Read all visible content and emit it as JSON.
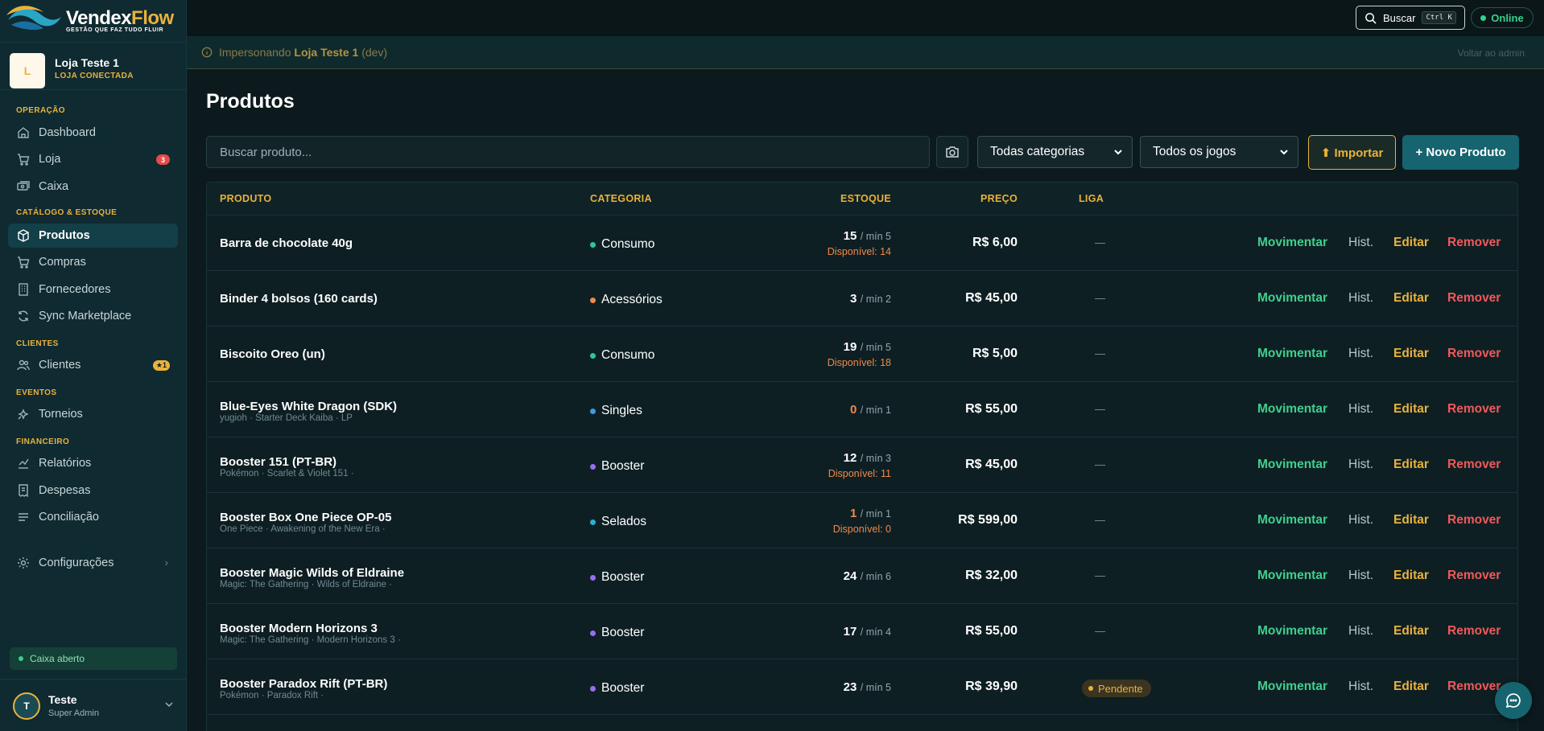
{
  "brand": {
    "name": "Vendex",
    "flow": "Flow",
    "tagline": "GESTÃO QUE FAZ TUDO FLUIR"
  },
  "store": {
    "initial": "L",
    "name": "Loja Teste 1",
    "status": "LOJA CONECTADA"
  },
  "nav": {
    "sections": {
      "operacao": "OPERAÇÃO",
      "catalogo": "CATÁLOGO & ESTOQUE",
      "clientes": "CLIENTES",
      "eventos": "EVENTOS",
      "financeiro": "FINANCEIRO"
    },
    "items": {
      "dashboard": "Dashboard",
      "loja": "Loja",
      "loja_badge": "3",
      "caixa": "Caixa",
      "produtos": "Produtos",
      "compras": "Compras",
      "fornecedores": "Fornecedores",
      "sync": "Sync Marketplace",
      "clientes": "Clientes",
      "clientes_badge": "★1",
      "torneios": "Torneios",
      "relatorios": "Relatórios",
      "despesas": "Despesas",
      "conciliacao": "Conciliação",
      "configuracoes": "Configurações"
    }
  },
  "caixa_status": "Caixa aberto",
  "user": {
    "initial": "T",
    "name": "Teste",
    "role": "Super Admin"
  },
  "topbar": {
    "search_label": "Buscar",
    "shortcut": "Ctrl K",
    "status": "Online"
  },
  "impersonation": {
    "prefix": "Impersonando",
    "store": "Loja Teste 1",
    "suffix": "(dev)",
    "back": "Voltar ao admin"
  },
  "page": {
    "title": "Produtos",
    "search_placeholder": "Buscar produto...",
    "category_select": "Todas categorias",
    "game_select": "Todos os jogos",
    "import_label": "⬆ Importar",
    "new_label": "+ Novo Produto"
  },
  "table": {
    "headers": {
      "produto": "PRODUTO",
      "categoria": "CATEGORIA",
      "estoque": "ESTOQUE",
      "preco": "PREÇO",
      "liga": "LIGA"
    },
    "actions": {
      "mov": "Movimentar",
      "hist": "Hist.",
      "edit": "Editar",
      "remove": "Remover"
    },
    "rows": [
      {
        "name": "Barra de chocolate 40g",
        "sub": "",
        "category": "Consumo",
        "cat_color": "#2ec4a0",
        "qty": "15",
        "min": "/ mín 5",
        "avail": "Disponível: 14",
        "warn": false,
        "price": "R$ 6,00",
        "liga": "—"
      },
      {
        "name": "Binder 4 bolsos (160 cards)",
        "sub": "",
        "category": "Acessórios",
        "cat_color": "#f0894a",
        "qty": "3",
        "min": "/ mín 2",
        "avail": "",
        "warn": false,
        "price": "R$ 45,00",
        "liga": "—"
      },
      {
        "name": "Biscoito Oreo (un)",
        "sub": "",
        "category": "Consumo",
        "cat_color": "#2ec4a0",
        "qty": "19",
        "min": "/ mín 5",
        "avail": "Disponível: 18",
        "warn": false,
        "price": "R$ 5,00",
        "liga": "—"
      },
      {
        "name": "Blue-Eyes White Dragon (SDK)",
        "sub": "yugioh · Starter Deck Kaiba · LP",
        "category": "Singles",
        "cat_color": "#3b9be0",
        "qty": "0",
        "min": "/ mín 1",
        "avail": "",
        "warn": true,
        "price": "R$ 55,00",
        "liga": "—"
      },
      {
        "name": "Booster 151 (PT-BR)",
        "sub": "Pokémon · Scarlet & Violet 151 ·",
        "category": "Booster",
        "cat_color": "#9b6cf0",
        "qty": "12",
        "min": "/ mín 3",
        "avail": "Disponível: 11",
        "warn": false,
        "price": "R$ 45,00",
        "liga": "—"
      },
      {
        "name": "Booster Box One Piece OP-05",
        "sub": "One Piece · Awakening of the New Era ·",
        "category": "Selados",
        "cat_color": "#2ab0d0",
        "qty": "1",
        "min": "/ mín 1",
        "avail": "Disponível: 0",
        "warn": true,
        "price": "R$ 599,00",
        "liga": "—"
      },
      {
        "name": "Booster Magic Wilds of Eldraine",
        "sub": "Magic: The Gathering · Wilds of Eldraine ·",
        "category": "Booster",
        "cat_color": "#9b6cf0",
        "qty": "24",
        "min": "/ mín 6",
        "avail": "",
        "warn": false,
        "price": "R$ 32,00",
        "liga": "—"
      },
      {
        "name": "Booster Modern Horizons 3",
        "sub": "Magic: The Gathering · Modern Horizons 3 ·",
        "category": "Booster",
        "cat_color": "#9b6cf0",
        "qty": "17",
        "min": "/ mín 4",
        "avail": "",
        "warn": false,
        "price": "R$ 55,00",
        "liga": "—"
      },
      {
        "name": "Booster Paradox Rift (PT-BR)",
        "sub": "Pokémon · Paradox Rift ·",
        "category": "Booster",
        "cat_color": "#9b6cf0",
        "qty": "23",
        "min": "/ mín 5",
        "avail": "",
        "warn": false,
        "price": "R$ 39,90",
        "liga": "Pendente",
        "liga_pill": true
      }
    ]
  }
}
